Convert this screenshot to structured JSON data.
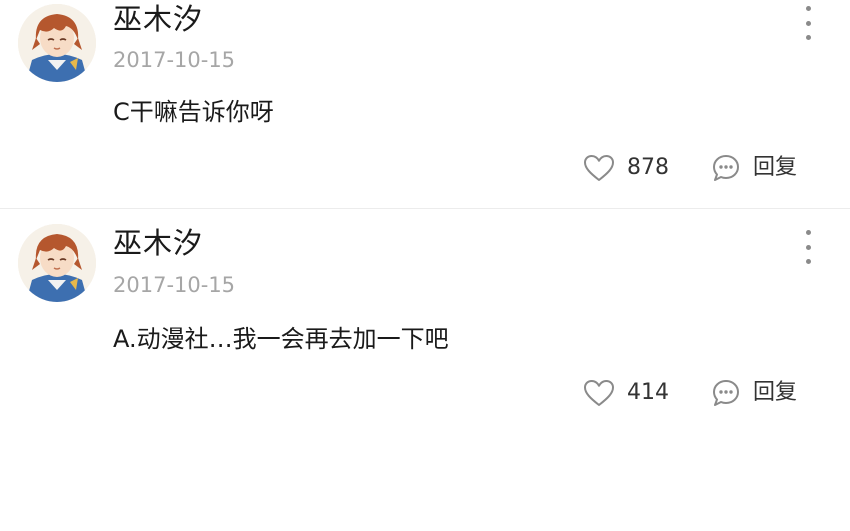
{
  "comments": [
    {
      "username": "巫木汐",
      "date": "2017-10-15",
      "text": "C干嘛告诉你呀",
      "likes": "878",
      "reply_label": "回复"
    },
    {
      "username": "巫木汐",
      "date": "2017-10-15",
      "text": "A.动漫社…我一会再去加一下吧",
      "likes": "414",
      "reply_label": "回复"
    }
  ],
  "icons": {
    "like": "heart-outline-icon",
    "reply": "chat-bubble-icon",
    "more": "vertical-ellipsis-icon",
    "avatar": "anime-character-avatar"
  },
  "colors": {
    "text": "#1a1a1a",
    "muted": "#a6a6a6",
    "icon": "#8a8a8a",
    "divider": "#ececec"
  }
}
